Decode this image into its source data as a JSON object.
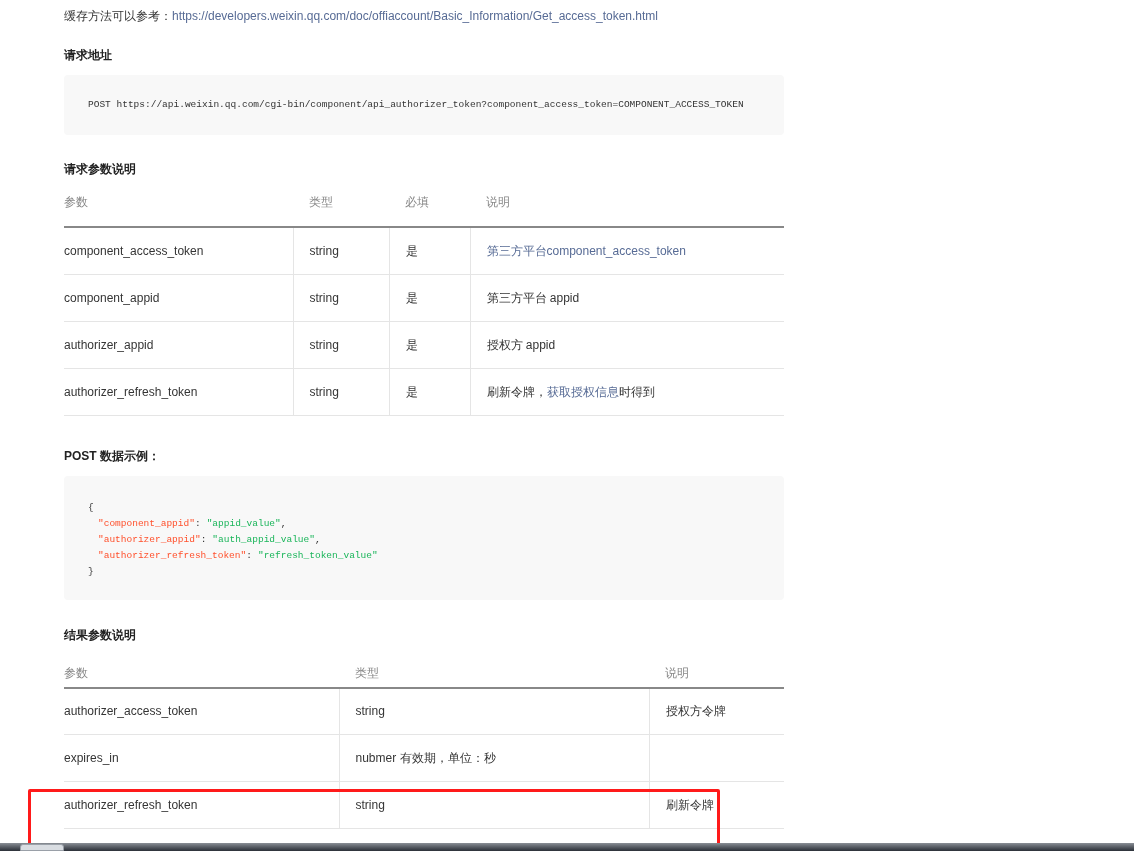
{
  "cache_note": {
    "prefix": "缓存方法可以参考：",
    "link": "https://developers.weixin.qq.com/doc/offiaccount/Basic_Information/Get_access_token.html"
  },
  "request_url": {
    "heading": "请求地址",
    "code": "POST https://api.weixin.qq.com/cgi-bin/component/api_authorizer_token?component_access_token=COMPONENT_ACCESS_TOKEN"
  },
  "request_params": {
    "heading": "请求参数说明",
    "columns": [
      "参数",
      "类型",
      "必填",
      "说明"
    ],
    "rows": [
      {
        "name": "component_access_token",
        "type": "string",
        "required": "是",
        "desc": [
          {
            "text": "第三方平台component_access_token",
            "link": true
          }
        ]
      },
      {
        "name": "component_appid",
        "type": "string",
        "required": "是",
        "desc": [
          {
            "text": "第三方平台 appid",
            "link": false
          }
        ]
      },
      {
        "name": "authorizer_appid",
        "type": "string",
        "required": "是",
        "desc": [
          {
            "text": "授权方 appid",
            "link": false
          }
        ]
      },
      {
        "name": "authorizer_refresh_token",
        "type": "string",
        "required": "是",
        "desc": [
          {
            "text": "刷新令牌，",
            "link": false
          },
          {
            "text": "获取授权信息",
            "link": true
          },
          {
            "text": "时得到",
            "link": false
          }
        ]
      }
    ]
  },
  "post_example": {
    "heading": "POST 数据示例：",
    "open": "{",
    "close": "}",
    "entries": [
      {
        "key": "\"component_appid\"",
        "colon": ":",
        "value": "\"appid_value\"",
        "sep": ","
      },
      {
        "key": "\"authorizer_appid\"",
        "colon": ":",
        "value": "\"auth_appid_value\"",
        "sep": ","
      },
      {
        "key": "\"authorizer_refresh_token\"",
        "colon": ":",
        "value": "\"refresh_token_value\""
      }
    ]
  },
  "result_params": {
    "heading": "结果参数说明",
    "columns": [
      "参数",
      "类型",
      "说明"
    ],
    "rows": [
      {
        "name": "authorizer_access_token",
        "type": "string",
        "desc": "授权方令牌",
        "highlighted": false
      },
      {
        "name": "expires_in",
        "type": "nubmer 有效期，单位：秒",
        "highlighted": false
      },
      {
        "name": "authorizer_refresh_token",
        "type": "string",
        "desc": "刷新令牌",
        "highlighted": true
      }
    ]
  }
}
